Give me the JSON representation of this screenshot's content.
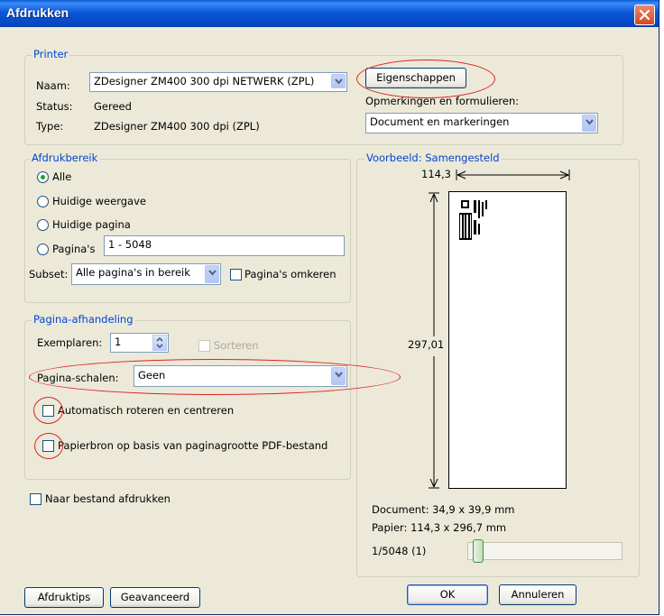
{
  "window": {
    "title": "Afdrukken",
    "close_icon": "close-icon"
  },
  "printer": {
    "group_label": "Printer",
    "name_label": "Naam:",
    "name_value": "ZDesigner ZM400 300 dpi NETWERK (ZPL)",
    "status_label": "Status:",
    "status_value": "Gereed",
    "type_label": "Type:",
    "type_value": "ZDesigner ZM400 300 dpi (ZPL)",
    "properties_button": "Eigenschappen",
    "comments_label": "Opmerkingen en formulieren:",
    "comments_value": "Document en markeringen"
  },
  "range": {
    "group_label": "Afdrukbereik",
    "options": [
      "Alle",
      "Huidige weergave",
      "Huidige pagina",
      "Pagina's"
    ],
    "selected": "Alle",
    "pages_value": "1 - 5048",
    "subset_label": "Subset:",
    "subset_value": "Alle pagina's in bereik",
    "reverse_label": "Pagina's omkeren"
  },
  "handling": {
    "group_label": "Pagina-afhandeling",
    "copies_label": "Exemplaren:",
    "copies_value": "1",
    "collate_label": "Sorteren",
    "scaling_label": "Pagina-schalen:",
    "scaling_value": "Geen",
    "auto_rotate_label": "Automatisch roteren en centreren",
    "paper_source_label": "Papierbron op basis van paginagrootte PDF-bestand"
  },
  "print_to_file_label": "Naar bestand afdrukken",
  "preview": {
    "group_label": "Voorbeeld: Samengesteld",
    "width_value": "114,3",
    "height_value": "297,01",
    "document_size": "Document: 34,9 x 39,9 mm",
    "paper_size": "Papier: 114,3 x 296,7 mm",
    "page_counter": "1/5048 (1)",
    "page_slider_fraction": 0.0
  },
  "buttons": {
    "tips": "Afdruktips",
    "advanced": "Geavanceerd",
    "ok": "OK",
    "cancel": "Annuleren"
  },
  "colors": {
    "titlebar": "#0a5bd6",
    "group_label": "#0046d5",
    "annotation_ellipse": "#d9252a",
    "radio_dot": "#21a121"
  }
}
